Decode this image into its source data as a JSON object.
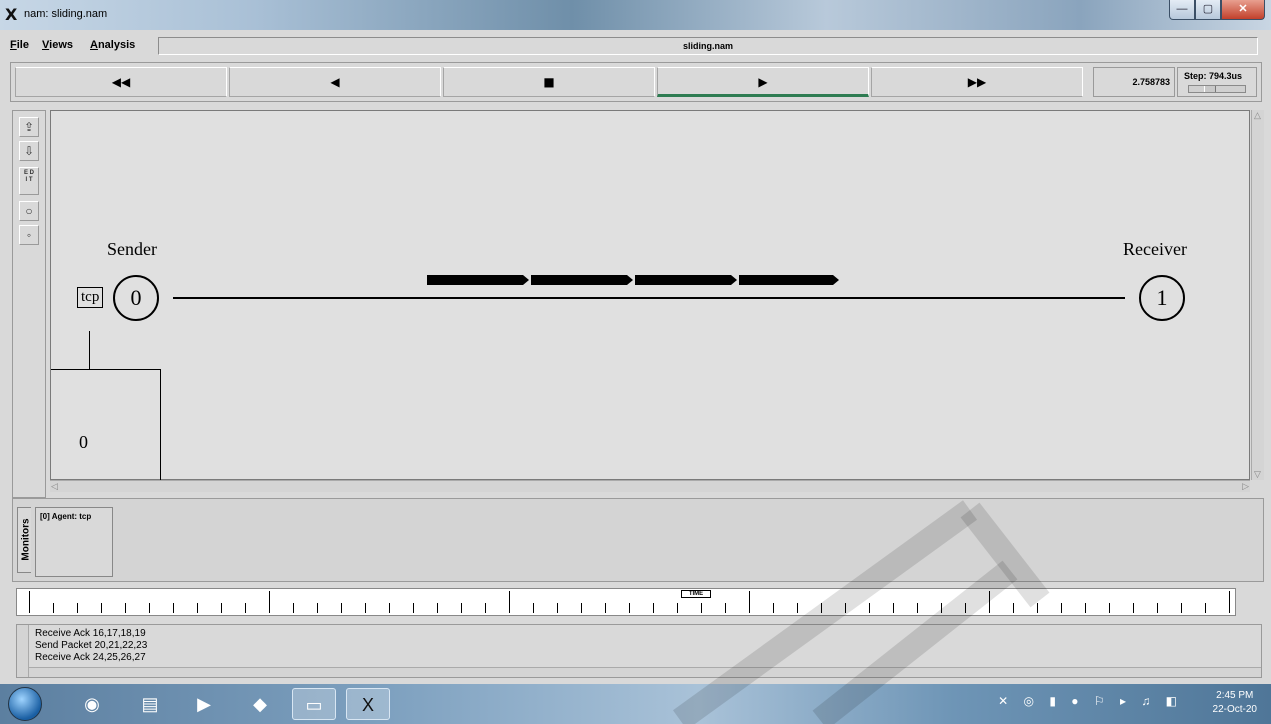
{
  "window": {
    "app_icon": "X",
    "title": "nam: sliding.nam",
    "controls": {
      "minimize": "—",
      "maximize": "▢",
      "close": "✕"
    }
  },
  "menu": {
    "items": [
      {
        "label": "File",
        "key": "F",
        "rest": "ile"
      },
      {
        "label": "Views",
        "key": "V",
        "rest": "iews"
      },
      {
        "label": "Analysis",
        "key": "A",
        "rest": "nalysis"
      }
    ],
    "file_title": "sliding.nam"
  },
  "controls": {
    "rewind": "◀◀",
    "back": "◀",
    "stop": "■",
    "play": "▶",
    "fast_forward": "▶▶",
    "time": "2.758783",
    "step_label": "Step: 794.3us"
  },
  "tools": {
    "zoom_in": "⇪",
    "zoom_out": "⇩",
    "edit": "E D\nI T",
    "circle_tool": "○",
    "node_tool": "◦"
  },
  "topology": {
    "sender_label": "Sender",
    "receiver_label": "Receiver",
    "node0_id": "0",
    "node1_id": "1",
    "agent_label": "tcp",
    "monitor_value": "0"
  },
  "monitors": {
    "tab_label": "Monitors",
    "agent_monitor": "[0] Agent: tcp"
  },
  "timeline": {
    "marker_label": "TIME"
  },
  "log": {
    "lines": [
      "Receive Ack 16,17,18,19",
      "Send Packet 20,21,22,23",
      "Receive Ack 24,25,26,27"
    ]
  },
  "taskbar": {
    "time": "2:45 PM",
    "date": "22-Oct-20"
  },
  "colors": {
    "canvas_bg": "#e0e0e0",
    "packet": "#000000",
    "play_indicator": "#2e7c52"
  }
}
